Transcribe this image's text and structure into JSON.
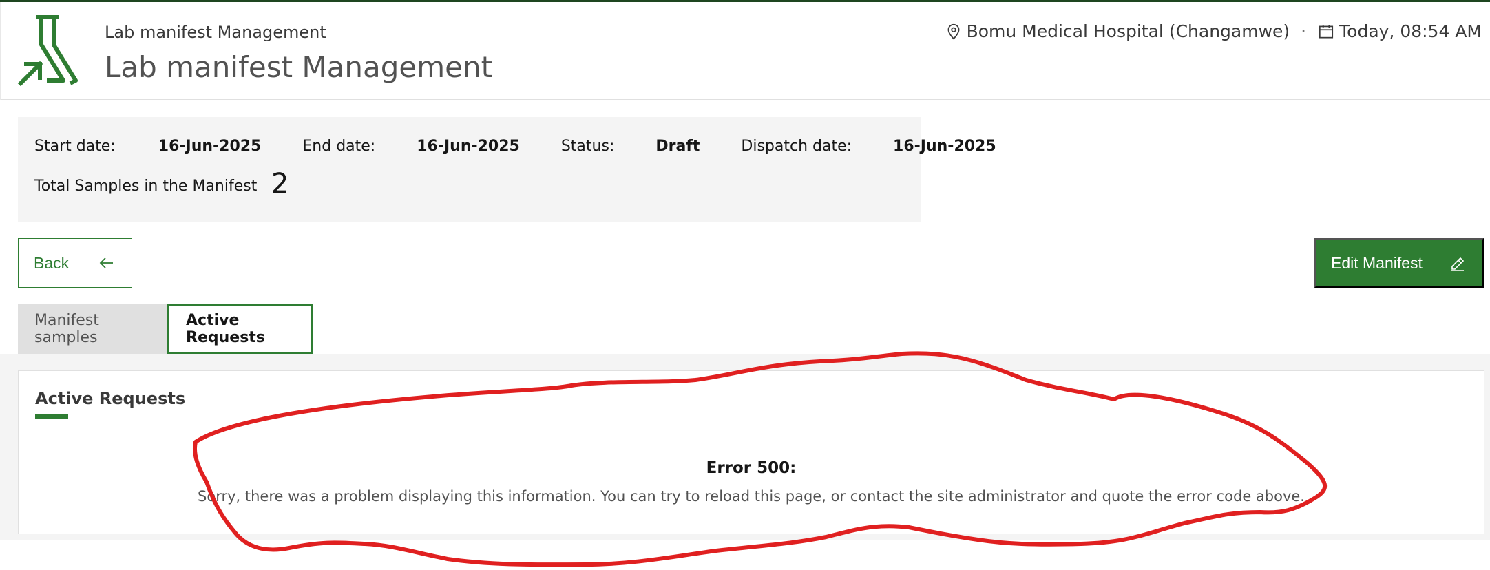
{
  "header": {
    "app_subtitle": "Lab manifest Management",
    "app_title": "Lab manifest Management",
    "location": "Bomu Medical Hospital (Changamwe)",
    "separator": "·",
    "datetime": "Today, 08:54 AM",
    "logo_icon": "flask-arrow-icon",
    "location_icon": "location-pin-icon",
    "calendar_icon": "calendar-icon"
  },
  "summary": {
    "start_label": "Start date:",
    "start_value": "16-Jun-2025",
    "end_label": "End date:",
    "end_value": "16-Jun-2025",
    "status_label": "Status:",
    "status_value": "Draft",
    "dispatch_label": "Dispatch date:",
    "dispatch_value": "16-Jun-2025",
    "total_label": "Total Samples in the Manifest",
    "total_value": "2"
  },
  "actions": {
    "back_label": "Back",
    "back_icon": "arrow-left-icon",
    "edit_label": "Edit Manifest",
    "edit_icon": "pencil-icon"
  },
  "tabs": [
    {
      "label": "Manifest samples",
      "active": false
    },
    {
      "label": "Active Requests",
      "active": true
    }
  ],
  "panel": {
    "title": "Active Requests",
    "error_title": "Error 500:",
    "error_message": "Sorry, there was a problem displaying this information. You can try to reload this page, or contact the site administrator and quote the error code above."
  },
  "colors": {
    "brand_green": "#2e7d32",
    "annotation_red": "#e02020"
  }
}
